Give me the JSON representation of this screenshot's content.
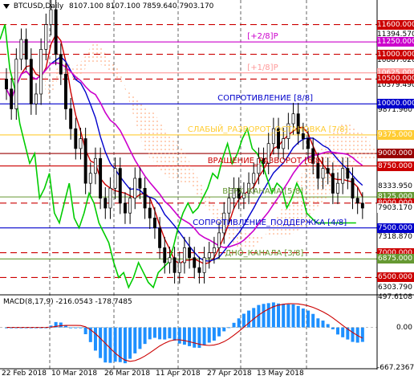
{
  "header": {
    "symbol_timeframe": "BTCUSD,Daily",
    "ohlc": "8107.100 8107.100 7859.640 7903.170"
  },
  "macd": {
    "label": "MACD(8,17,9) -216.0543 -178.7485"
  },
  "price_axis": [
    {
      "text": "11394.570",
      "v": 11394.57
    },
    {
      "text": "10887.020",
      "v": 10887.02
    },
    {
      "text": "10379.490",
      "v": 10379.49
    },
    {
      "text": "9871.960",
      "v": 9871.96
    },
    {
      "text": "8333.950",
      "v": 8333.95
    },
    {
      "text": "7318.870",
      "v": 7318.87
    },
    {
      "text": "6811.340",
      "v": 6811.34
    },
    {
      "text": "6303.790",
      "v": 6303.79
    }
  ],
  "price_badges": [
    {
      "text": "11600.000",
      "v": 11600,
      "bg": "#cc0000",
      "fg": "#ffffff"
    },
    {
      "text": "11250.000",
      "v": 11250,
      "bg": "#cc00cc",
      "fg": "#ffffff"
    },
    {
      "text": "11000.000",
      "v": 11000,
      "bg": "#cc0000",
      "fg": "#ffffff"
    },
    {
      "text": "10625.000",
      "v": 10625,
      "bg": "#ff9999",
      "fg": "#ffffff"
    },
    {
      "text": "10500.000",
      "v": 10500,
      "bg": "#cc0000",
      "fg": "#ffffff"
    },
    {
      "text": "10000.000",
      "v": 10000,
      "bg": "#0000cc",
      "fg": "#ffffff"
    },
    {
      "text": "9375.000",
      "v": 9375,
      "bg": "#ffcc33",
      "fg": "#ffffff"
    },
    {
      "text": "9000.000",
      "v": 9000,
      "bg": "#990000",
      "fg": "#ffffff"
    },
    {
      "text": "8750.000",
      "v": 8750,
      "bg": "#cc0000",
      "fg": "#ffffff"
    },
    {
      "text": "8125.000",
      "v": 8125,
      "bg": "#669933",
      "fg": "#ffffff"
    },
    {
      "text": "8000.000",
      "v": 8000,
      "bg": "#cc0000",
      "fg": "#ffffff"
    },
    {
      "text": "7903.170",
      "v": 7903.17,
      "bg": "#ffffff",
      "fg": "#000000"
    },
    {
      "text": "7500.000",
      "v": 7500,
      "bg": "#0000cc",
      "fg": "#ffffff"
    },
    {
      "text": "7000.000",
      "v": 7000,
      "bg": "#cc0000",
      "fg": "#ffffff"
    },
    {
      "text": "6875.000",
      "v": 6875,
      "bg": "#669933",
      "fg": "#ffffff"
    },
    {
      "text": "6500.000",
      "v": 6500,
      "bg": "#cc0000",
      "fg": "#ffffff"
    }
  ],
  "macd_axis": [
    {
      "text": "497.6108",
      "v": 497.61
    },
    {
      "text": "0.00",
      "v": 0
    },
    {
      "text": "-667.2367",
      "v": -667.24
    }
  ],
  "levels": [
    {
      "v": 11600,
      "color": "#cc0000",
      "style": "dashed"
    },
    {
      "v": 11250,
      "color": "#cc00cc",
      "style": "solid",
      "label": "[+2/8]P",
      "label_color": "#cc00cc"
    },
    {
      "v": 11000,
      "color": "#cc0000",
      "style": "dashed"
    },
    {
      "v": 10625,
      "color": "#ff9999",
      "style": "solid",
      "label": "[+1/8]P",
      "label_color": "#ff9999"
    },
    {
      "v": 10500,
      "color": "#cc0000",
      "style": "dashed"
    },
    {
      "v": 10000,
      "color": "#0000cc",
      "style": "solid",
      "label": "СОПРОТИВЛЕНИЕ [8/8]",
      "label_color": "#0000cc"
    },
    {
      "v": 9375,
      "color": "#ffcc33",
      "style": "solid",
      "label": "СЛАБЫЙ_РАЗВОРОТ_ОСТАНОВКА [7/8]",
      "label_color": "#ffcc33"
    },
    {
      "v": 9000,
      "color": "#990000",
      "style": "solid"
    },
    {
      "v": 8750,
      "color": "#cc0000",
      "style": "solid",
      "label": "ВРАЩЕНИЕ_РАЗВОРОТ [6/8]",
      "label_color": "#cc0000"
    },
    {
      "v": 8125,
      "color": "#669933",
      "style": "solid",
      "label": "ВЕРХ_КАНАЛА [5/8]",
      "label_color": "#669933"
    },
    {
      "v": 8000,
      "color": "#cc0000",
      "style": "dashed"
    },
    {
      "v": 7500,
      "color": "#0000cc",
      "style": "solid",
      "label": "СОПРОТИВЛЕНИЕ_ПОДДЕРЖКА [4/8]",
      "label_color": "#0000cc"
    },
    {
      "v": 7000,
      "color": "#cc0000",
      "style": "dashed"
    },
    {
      "v": 6875,
      "color": "#669933",
      "style": "solid",
      "label": "ДНО_КАНАЛА [3/8]",
      "label_color": "#669933"
    },
    {
      "v": 6500,
      "color": "#cc0000",
      "style": "dashed"
    }
  ],
  "time_axis": [
    "22 Feb 2018",
    "10 Mar 2018",
    "26 Mar 2018",
    "11 Apr 2018",
    "27 Apr 2018",
    "13 May 2018"
  ],
  "series": {
    "close": [
      10300,
      9900,
      10900,
      11300,
      10900,
      10000,
      10200,
      11100,
      11600,
      11900,
      11000,
      10600,
      9900,
      9500,
      9100,
      9300,
      8400,
      8600,
      8900,
      8100,
      7900,
      8300,
      8700,
      8000,
      7800,
      8100,
      8500,
      8300,
      7900,
      7700,
      7500,
      7100,
      6800,
      6900,
      6600,
      6800,
      7100,
      6900,
      6700,
      6600,
      6900,
      7000,
      7100,
      7400,
      7800,
      8100,
      8300,
      8100,
      8200,
      8400,
      8600,
      8900,
      8800,
      9200,
      9500,
      9100,
      9300,
      9600,
      9800,
      9400,
      9300,
      9100,
      8800,
      8500,
      8700,
      8600,
      8200,
      8400,
      8700,
      8500,
      8100,
      8000,
      7900
    ]
  },
  "colors": {
    "candle": "#000000",
    "ma_red": "#cc0000",
    "ma_blue": "#0000cc",
    "chikou_green": "#00cc00",
    "kumo_magenta": "#cc00cc",
    "macd_hist": "#1e90ff",
    "macd_signal": "#cc0000"
  }
}
